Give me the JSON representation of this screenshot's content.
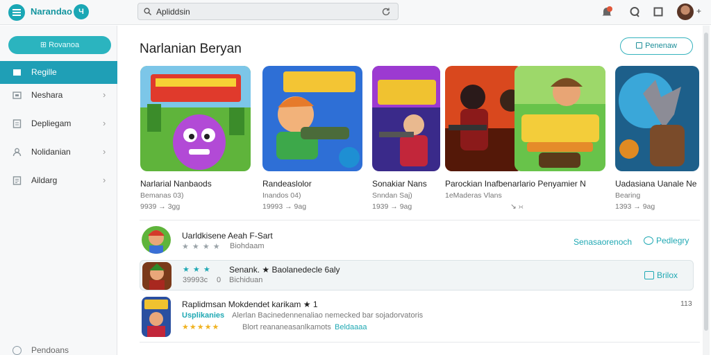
{
  "app": {
    "title": "Narandao",
    "badge": "Ч"
  },
  "search": {
    "placeholder": "Apliddsin"
  },
  "sidebar": {
    "new_button": "⊞ Rovanoa",
    "items": [
      {
        "label": "Regille",
        "icon": "home-icon",
        "active": true
      },
      {
        "label": "Neshara",
        "icon": "store-icon"
      },
      {
        "label": "Depliegam",
        "icon": "library-icon"
      },
      {
        "label": "Nolidanian",
        "icon": "user-icon"
      },
      {
        "label": "Aildarg",
        "icon": "document-icon"
      }
    ],
    "footer": "Pendoans"
  },
  "section": {
    "title": "Narlanian Beryan",
    "button": "Penenaw"
  },
  "featured": [
    {
      "name": "Narlarial Nanbaods",
      "sub": "Bemanas 03)",
      "meta": "9939 → 3gg"
    },
    {
      "name": "Randeaslolor",
      "sub": "Inandos 04)",
      "meta": "19993 → 9ag"
    },
    {
      "name": "Sonakiar Nans",
      "sub": "Snndan Saj)",
      "meta": "1939 → 9ag"
    },
    {
      "name": "Parockian Inafbenarlario Penyamier N",
      "sub": "1eMaderas Vlans",
      "meta": "↘ ›‹"
    },
    {
      "name": "Uadasiana Uanale Ne",
      "sub": "Bearing",
      "meta": "1393 → 9ag"
    }
  ],
  "list": [
    {
      "title": "Uarldkisene Aeah F-Sart",
      "stars": "★ ★ ★ ★",
      "sub": "Biohdaam",
      "link1": "Senasaorenoch",
      "link2": "Pedlegry"
    },
    {
      "title": "Senank. ★ Baolanedecle 6aly",
      "stars": "★ ★ ★",
      "sub_a": "39993c",
      "sub_b": "0",
      "sub_c": "Bichiduan",
      "link2": "Brilox"
    },
    {
      "title": "Raplidmsan Mokdendet karikam ★ 1",
      "tag": "Usplikanies",
      "desc": "Alerlan Bacinedennenaliao nemecked bar sojadorvatoris",
      "stars": "★★★★★",
      "sub": "Blort reananeasanlkamots",
      "sub_link": "Beldaaaa",
      "num": "113"
    }
  ],
  "colors": {
    "accent": "#1aa7b5",
    "active_nav": "#1f9fb6"
  }
}
